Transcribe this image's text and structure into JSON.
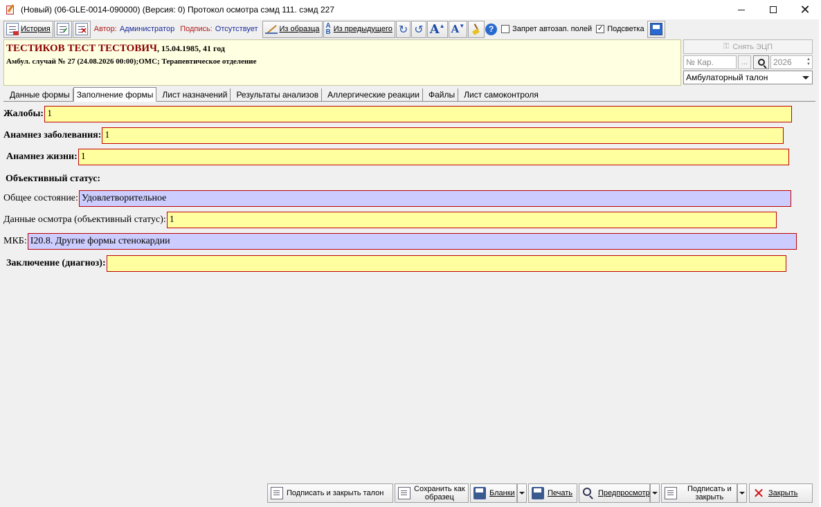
{
  "window": {
    "title": "(Новый) (06-GLE-0014-090000) (Версия: 0) Протокол осмотра  сэмд 111. сэмд 227"
  },
  "toolbar": {
    "history_label": "История",
    "author_label": "Автор:",
    "author_value": "Администратор",
    "sign_label": "Подпись:",
    "sign_value": "Отсутствует",
    "from_sample_label": "Из образца",
    "from_previous_label": "Из предыдущего",
    "font_bigger": "A",
    "font_smaller": "A",
    "help": "?",
    "autofill_ban_label": "Запрет автозап. полей",
    "autofill_ban_checked": "",
    "highlight_label": "Подсветка",
    "highlight_checked": "✓"
  },
  "patient": {
    "name": "ТЕСТИКОВ ТЕСТ ТЕСТОВИЧ",
    "info": ", 15.04.1985, 41 год",
    "case": "Амбул. случай  № 27 (24.08.2026 00:00);ОМС; Терапевтическое отделение"
  },
  "right_panel": {
    "remove_ecp_label": "Снять ЭЦП",
    "card_placeholder": "№ Кар.",
    "dots": "...",
    "year": "2026",
    "talon_type": "Амбулаторный талон"
  },
  "tabs": [
    {
      "label": "Данные формы"
    },
    {
      "label": "Заполнение формы"
    },
    {
      "label": "Лист назначений"
    },
    {
      "label": "Результаты анализов"
    },
    {
      "label": "Аллергические реакции"
    },
    {
      "label": "Файлы"
    },
    {
      "label": "Лист самоконтроля"
    }
  ],
  "form": {
    "complaints_label": "Жалобы:",
    "complaints_value": "1",
    "anamnesis_disease_label": "Анамнез заболевания:",
    "anamnesis_disease_value": "1",
    "anamnesis_life_label": "Анамнез жизни:",
    "anamnesis_life_value": "1",
    "objective_status_title": "Объективный статус:",
    "general_state_label": "Общее состояние:",
    "general_state_value": "Удовлетворительное",
    "exam_data_label": "Данные осмотра (объективный статус):",
    "exam_data_value": "1",
    "mkb_label": "МКБ:",
    "mkb_value": "I20.8. Другие формы стенокардии",
    "conclusion_label": "Заключение (диагноз):",
    "conclusion_value": ""
  },
  "bottom": {
    "sign_close_talon": "Подписать и закрыть талон",
    "save_as_sample_1": "Сохранить как",
    "save_as_sample_2": "образец",
    "blanks": "Бланки",
    "print": "Печать",
    "preview": "Предпросмотр",
    "sign_close_1": "Подписать и",
    "sign_close_2": "закрыть",
    "close": "Закрыть"
  }
}
